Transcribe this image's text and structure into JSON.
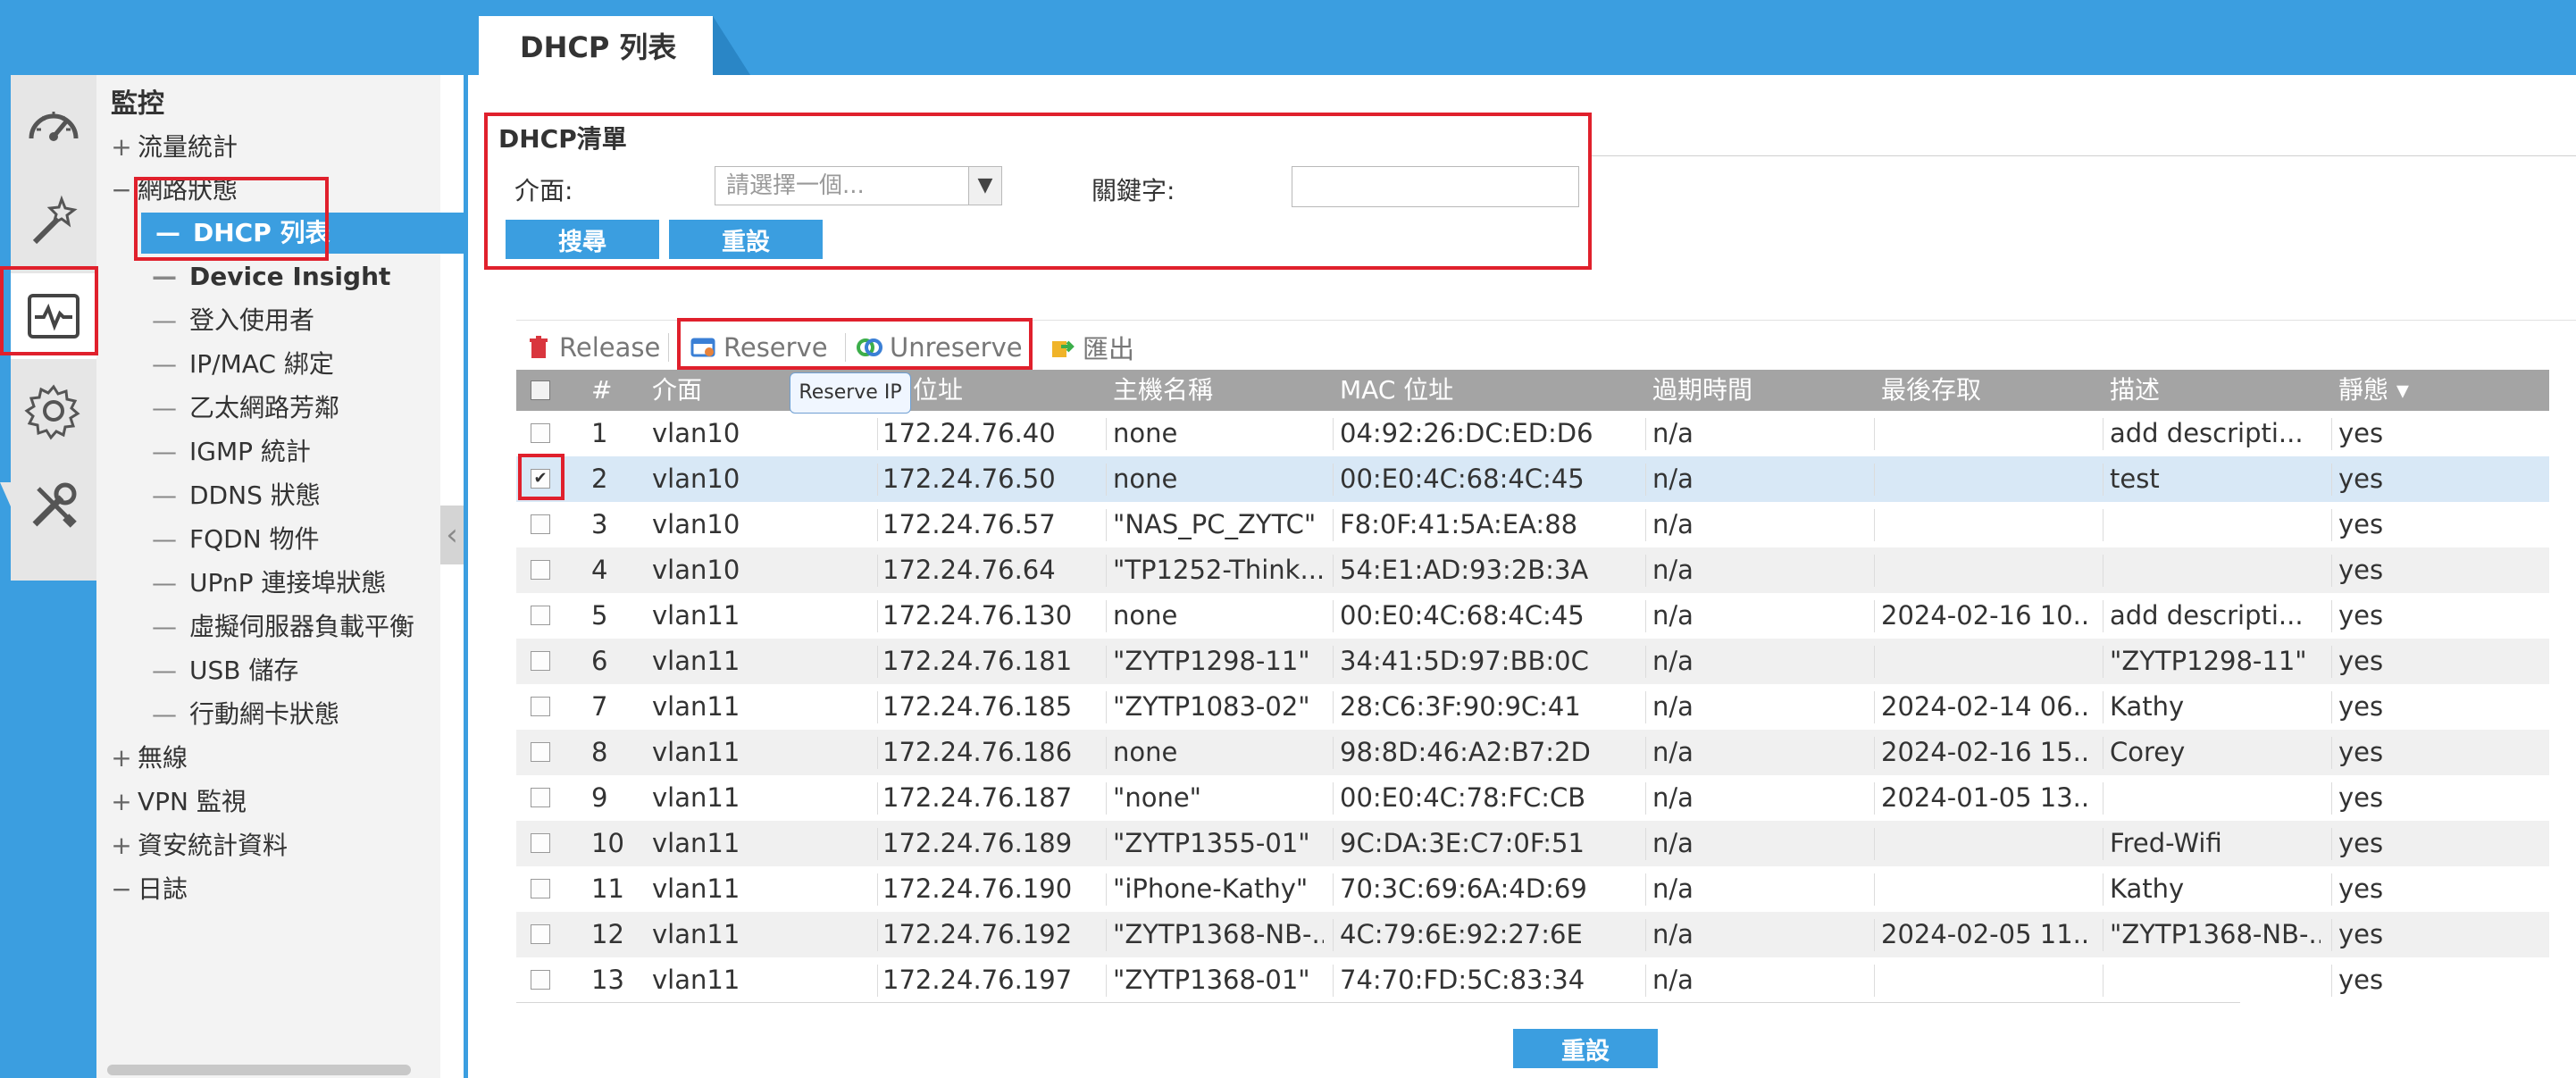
{
  "tab": {
    "title": "DHCP 列表"
  },
  "sidebar": {
    "root": "監控",
    "groups": {
      "traffic": "流量統計",
      "network": "網路狀態",
      "wireless": "無線",
      "vpn": "VPN 監視",
      "security": "資安統計資料",
      "log": "日誌"
    },
    "items": [
      "DHCP 列表",
      "Device Insight",
      "登入使用者",
      "IP/MAC 綁定",
      "乙太網路芳鄰",
      "IGMP 統計",
      "DDNS 狀態",
      "FQDN 物件",
      "UPnP 連接埠狀態",
      "虛擬伺服器負載平衡",
      "USB 儲存",
      "行動網卡狀態"
    ]
  },
  "filter": {
    "title": "DHCP清單",
    "interface_label": "介面:",
    "interface_placeholder": "請選擇一個...",
    "keyword_label": "關鍵字:",
    "search_button": "搜尋",
    "reset_button": "重設"
  },
  "toolbar": {
    "release": "Release",
    "reserve": "Reserve",
    "unreserve": "Unreserve",
    "export": "匯出",
    "tooltip": "Reserve IP"
  },
  "table": {
    "headers": [
      "#",
      "介面",
      "IP 位址",
      "主機名稱",
      "MAC 位址",
      "過期時間",
      "最後存取",
      "描述",
      "靜態 ▾"
    ],
    "rows": [
      {
        "n": "1",
        "iface": "vlan10",
        "ip": "172.24.76.40",
        "host": "none",
        "mac": "04:92:26:DC:ED:D6",
        "exp": "n/a",
        "last": "",
        "desc": "add descripti...",
        "static": "yes",
        "checked": false
      },
      {
        "n": "2",
        "iface": "vlan10",
        "ip": "172.24.76.50",
        "host": "none",
        "mac": "00:E0:4C:68:4C:45",
        "exp": "n/a",
        "last": "",
        "desc": "test",
        "static": "yes",
        "checked": true
      },
      {
        "n": "3",
        "iface": "vlan10",
        "ip": "172.24.76.57",
        "host": "\"NAS_PC_ZYTC\"",
        "mac": "F8:0F:41:5A:EA:88",
        "exp": "n/a",
        "last": "",
        "desc": "",
        "static": "yes",
        "checked": false
      },
      {
        "n": "4",
        "iface": "vlan10",
        "ip": "172.24.76.64",
        "host": "\"TP1252-Think...",
        "mac": "54:E1:AD:93:2B:3A",
        "exp": "n/a",
        "last": "",
        "desc": "",
        "static": "yes",
        "checked": false
      },
      {
        "n": "5",
        "iface": "vlan11",
        "ip": "172.24.76.130",
        "host": "none",
        "mac": "00:E0:4C:68:4C:45",
        "exp": "n/a",
        "last": "2024-02-16 10...",
        "desc": "add descripti...",
        "static": "yes",
        "checked": false
      },
      {
        "n": "6",
        "iface": "vlan11",
        "ip": "172.24.76.181",
        "host": "\"ZYTP1298-11\"",
        "mac": "34:41:5D:97:BB:0C",
        "exp": "n/a",
        "last": "",
        "desc": "\"ZYTP1298-11\"",
        "static": "yes",
        "checked": false
      },
      {
        "n": "7",
        "iface": "vlan11",
        "ip": "172.24.76.185",
        "host": "\"ZYTP1083-02\"",
        "mac": "28:C6:3F:90:9C:41",
        "exp": "n/a",
        "last": "2024-02-14 06...",
        "desc": "Kathy",
        "static": "yes",
        "checked": false
      },
      {
        "n": "8",
        "iface": "vlan11",
        "ip": "172.24.76.186",
        "host": "none",
        "mac": "98:8D:46:A2:B7:2D",
        "exp": "n/a",
        "last": "2024-02-16 15...",
        "desc": "Corey",
        "static": "yes",
        "checked": false
      },
      {
        "n": "9",
        "iface": "vlan11",
        "ip": "172.24.76.187",
        "host": "\"none\"",
        "mac": "00:E0:4C:78:FC:CB",
        "exp": "n/a",
        "last": "2024-01-05 13...",
        "desc": "",
        "static": "yes",
        "checked": false
      },
      {
        "n": "10",
        "iface": "vlan11",
        "ip": "172.24.76.189",
        "host": "\"ZYTP1355-01\"",
        "mac": "9C:DA:3E:C7:0F:51",
        "exp": "n/a",
        "last": "",
        "desc": "Fred-Wifi",
        "static": "yes",
        "checked": false
      },
      {
        "n": "11",
        "iface": "vlan11",
        "ip": "172.24.76.190",
        "host": "\"iPhone-Kathy\"",
        "mac": "70:3C:69:6A:4D:69",
        "exp": "n/a",
        "last": "",
        "desc": "Kathy",
        "static": "yes",
        "checked": false
      },
      {
        "n": "12",
        "iface": "vlan11",
        "ip": "172.24.76.192",
        "host": "\"ZYTP1368-NB-...",
        "mac": "4C:79:6E:92:27:6E",
        "exp": "n/a",
        "last": "2024-02-05 11...",
        "desc": "\"ZYTP1368-NB-...",
        "static": "yes",
        "checked": false
      },
      {
        "n": "13",
        "iface": "vlan11",
        "ip": "172.24.76.197",
        "host": "\"ZYTP1368-01\"",
        "mac": "74:70:FD:5C:83:34",
        "exp": "n/a",
        "last": "",
        "desc": "",
        "static": "yes",
        "checked": false
      }
    ]
  },
  "footer": {
    "reset_button": "重設"
  },
  "colors": {
    "accent": "#3b9ee0",
    "highlight": "#e0202c",
    "selected_row": "#d8e8f6"
  }
}
